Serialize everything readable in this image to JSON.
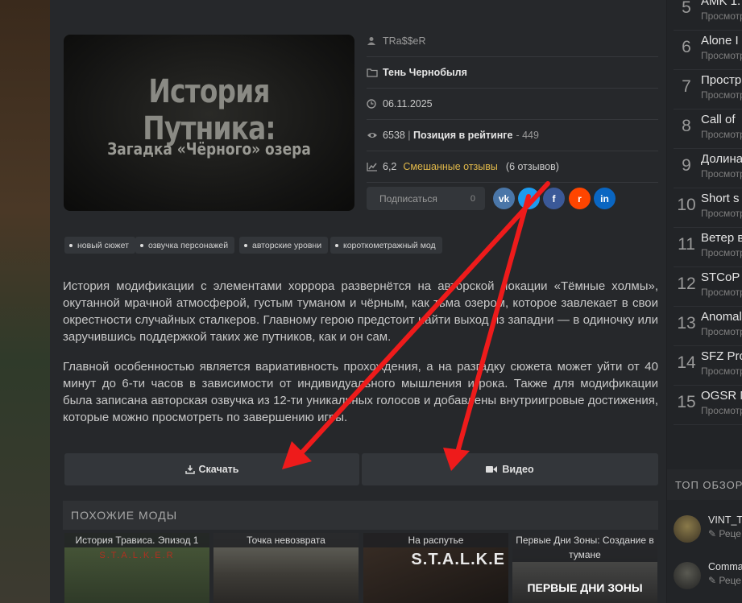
{
  "mod": {
    "cover_title": "История Путника:",
    "cover_subtitle": "Загадка «Чёрного» озера",
    "author": "TRa$$eR",
    "game": "Тень Чернобыля",
    "date": "06.11.2025",
    "views": "6538",
    "rating_label": "Позиция в рейтинге",
    "rating_position": "- 449",
    "score": "6,2",
    "score_label": "Смешанные отзывы",
    "reviews_count": "(6 отзывов)"
  },
  "subscribe": {
    "label": "Подписаться",
    "count": "0"
  },
  "share_buttons": [
    {
      "name": "vk",
      "glyph": "vk",
      "color": "#4a76a8"
    },
    {
      "name": "twitter",
      "glyph": "t",
      "color": "#1d9bf0"
    },
    {
      "name": "facebook",
      "glyph": "f",
      "color": "#3b5998"
    },
    {
      "name": "reddit",
      "glyph": "r",
      "color": "#ff4500"
    },
    {
      "name": "linkedin",
      "glyph": "in",
      "color": "#0a66c2"
    }
  ],
  "tags": [
    "новый сюжет",
    "озвучка персонажей",
    "авторские уровни",
    "короткометражный мод"
  ],
  "description": [
    "История модификации с элементами хоррора развернётся на авторской локации «Тёмные холмы», окутанной мрачной атмосферой, густым туманом и чёрным, как тьма озером, которое завлекает в свои окрестности случайных сталкеров. Главному герою предстоит найти выход из западни — в одиночку или заручившись поддержкой таких же путников, как и он сам.",
    "Главной особенностью является вариативность прохождения, а на разгадку сюжета может уйти от 40 минут до 6-ти часов в зависимости от индивидуального мышления игрока. Также для модификации была записана авторская озвучка из 12-ти уникальных голосов и добавлены внутриигровые достижения, которые можно просмотреть по завершению игры."
  ],
  "buttons": {
    "download": "Скачать",
    "video": "Видео"
  },
  "similar": {
    "heading": "ПОХОЖИЕ МОДЫ",
    "items": [
      {
        "title": "История Трависа. Эпизод 1",
        "art": "S.T.A.L.K.E.R"
      },
      {
        "title": "Точка невозврата",
        "art": ""
      },
      {
        "title": "На распутье",
        "art": "S.T.A.L.K.E"
      },
      {
        "title": "Первые Дни Зоны: Создание в тумане",
        "art": "ПЕРВЫЕ ДНИ ЗОНЫ"
      }
    ]
  },
  "sidebar": {
    "ranks": [
      {
        "n": "5",
        "title": "AMK 1.",
        "sub": "Просмотр"
      },
      {
        "n": "6",
        "title": "Alone I",
        "sub": "Просмотр"
      },
      {
        "n": "7",
        "title": "Простр",
        "sub": "Просмотр"
      },
      {
        "n": "8",
        "title": "Call of",
        "sub": "Просмотр"
      },
      {
        "n": "9",
        "title": "Долина",
        "sub": "Просмотр"
      },
      {
        "n": "10",
        "title": "Short s",
        "sub": "Просмотр"
      },
      {
        "n": "11",
        "title": "Ветер в",
        "sub": "Просмотр"
      },
      {
        "n": "12",
        "title": "STCoP",
        "sub": "Просмотр"
      },
      {
        "n": "13",
        "title": "Anomal",
        "sub": "Просмотр"
      },
      {
        "n": "14",
        "title": "SFZ Pro",
        "sub": "Просмотр"
      },
      {
        "n": "15",
        "title": "OGSR M",
        "sub": "Просмотр"
      }
    ],
    "top_heading": "ТОП ОБЗОР",
    "reviews": [
      {
        "name": "VINT_T",
        "sub": "Реце"
      },
      {
        "name": "Comma",
        "sub": "Реце"
      }
    ]
  }
}
